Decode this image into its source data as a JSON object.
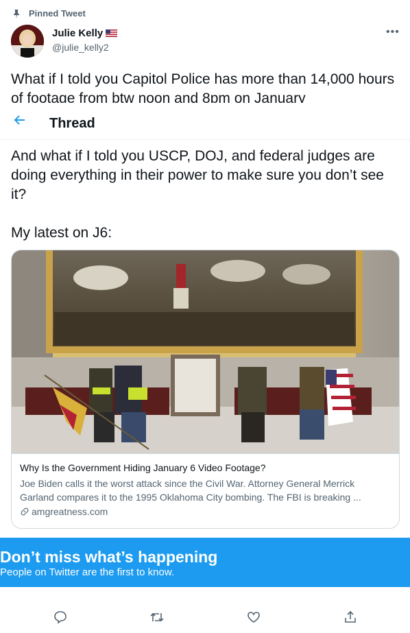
{
  "pinned_label": "Pinned Tweet",
  "author": {
    "name": "Julie Kelly",
    "handle": "@julie_kelly2"
  },
  "tweet": {
    "line1": "What if I told you Capitol Police has more than 14,000 hours of footage from btw noon and 8pm on January",
    "line2": "And what if I told you USCP, DOJ, and federal judges are doing everything in their power to make sure you don’t see it?",
    "line3": "My latest on J6:"
  },
  "header": {
    "title": "Thread"
  },
  "card": {
    "title": "Why Is the Government Hiding January 6 Video Footage?",
    "description": "Joe Biden calls it the worst attack since the Civil War. Attorney General Merrick Garland compares it to the 1995 Oklahoma City bombing. The FBI is breaking ...",
    "domain": "amgreatness.com"
  },
  "banner": {
    "heading": "Don’t miss what’s happening",
    "subtext": "People on Twitter are the first to know."
  },
  "colors": {
    "accent": "#1d9bf0",
    "muted": "#536471",
    "text": "#0f1419"
  },
  "icons": [
    "pin-icon",
    "flag-icon",
    "more-icon",
    "back-arrow-icon",
    "link-icon",
    "reply-icon",
    "retweet-icon",
    "like-icon",
    "share-icon"
  ]
}
